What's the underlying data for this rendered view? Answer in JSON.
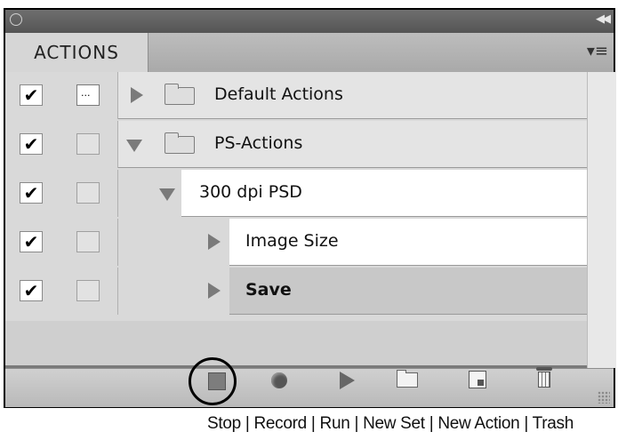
{
  "panel": {
    "tab_label": "ACTIONS",
    "menu_icon": "panel-menu-icon",
    "collapse_icon": "collapse-double-arrow-icon"
  },
  "rows": [
    {
      "label": "Default Actions",
      "checked": true,
      "dialog": true,
      "type": "set",
      "expanded": false
    },
    {
      "label": "PS-Actions",
      "checked": true,
      "dialog": false,
      "type": "set",
      "expanded": true
    },
    {
      "label": "300 dpi PSD",
      "checked": true,
      "dialog": false,
      "type": "action",
      "expanded": true
    },
    {
      "label": "Image Size",
      "checked": true,
      "dialog": false,
      "type": "step",
      "expanded": false
    },
    {
      "label": "Save",
      "checked": true,
      "dialog": false,
      "type": "step",
      "expanded": false,
      "selected": true
    }
  ],
  "checkmark": "✔",
  "toolbar": {
    "buttons": [
      "stop-icon",
      "record-icon",
      "run-icon",
      "new-set-icon",
      "new-action-icon",
      "trash-icon"
    ],
    "highlighted": "stop"
  },
  "caption": "Stop | Record | Run | New Set | New Action | Trash"
}
